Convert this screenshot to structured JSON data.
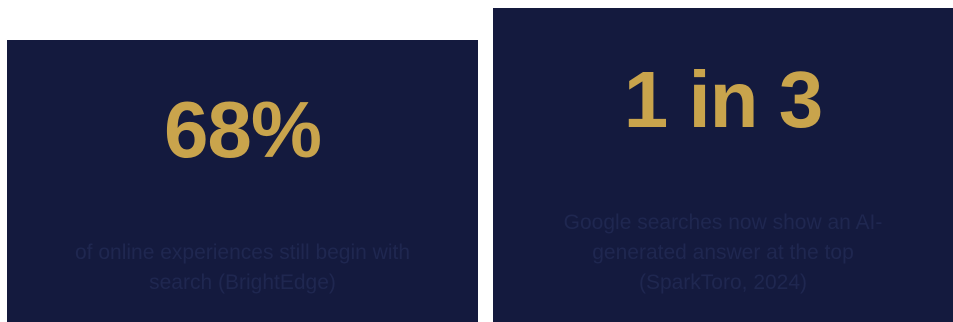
{
  "stats": [
    {
      "value": "68%",
      "caption": "of online experiences still begin with search (BrightEdge)"
    },
    {
      "value": "1 in 3",
      "caption": "Google searches now show an AI-generated answer at the top (SparkToro, 2024)"
    }
  ],
  "colors": {
    "card_background": "#141a3e",
    "stat_gold": "#c9a44c",
    "caption_text": "#1f2750",
    "page_background": "#ffffff"
  }
}
